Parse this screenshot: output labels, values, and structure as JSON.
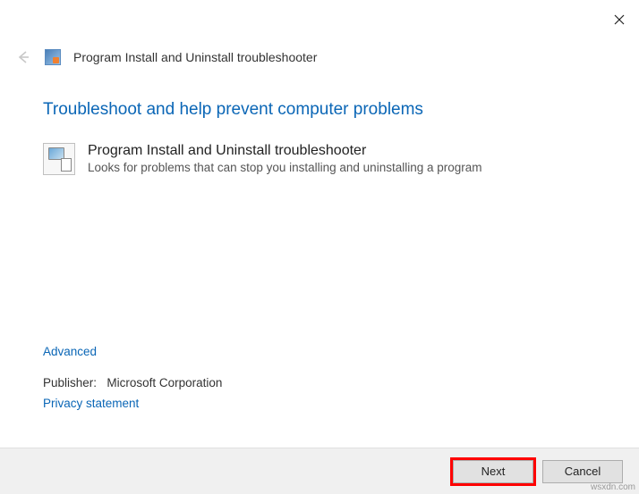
{
  "titlebar": {
    "close_label": "Close"
  },
  "header": {
    "title": "Program Install and Uninstall troubleshooter"
  },
  "main": {
    "heading": "Troubleshoot and help prevent computer problems",
    "troubleshooter": {
      "title": "Program Install and Uninstall troubleshooter",
      "description": "Looks for problems that can stop you installing and uninstalling a program"
    },
    "advanced_label": "Advanced",
    "publisher_label": "Publisher:",
    "publisher_value": "Microsoft Corporation",
    "privacy_label": "Privacy statement"
  },
  "footer": {
    "next_label": "Next",
    "cancel_label": "Cancel"
  },
  "watermark": "wsxdn.com"
}
